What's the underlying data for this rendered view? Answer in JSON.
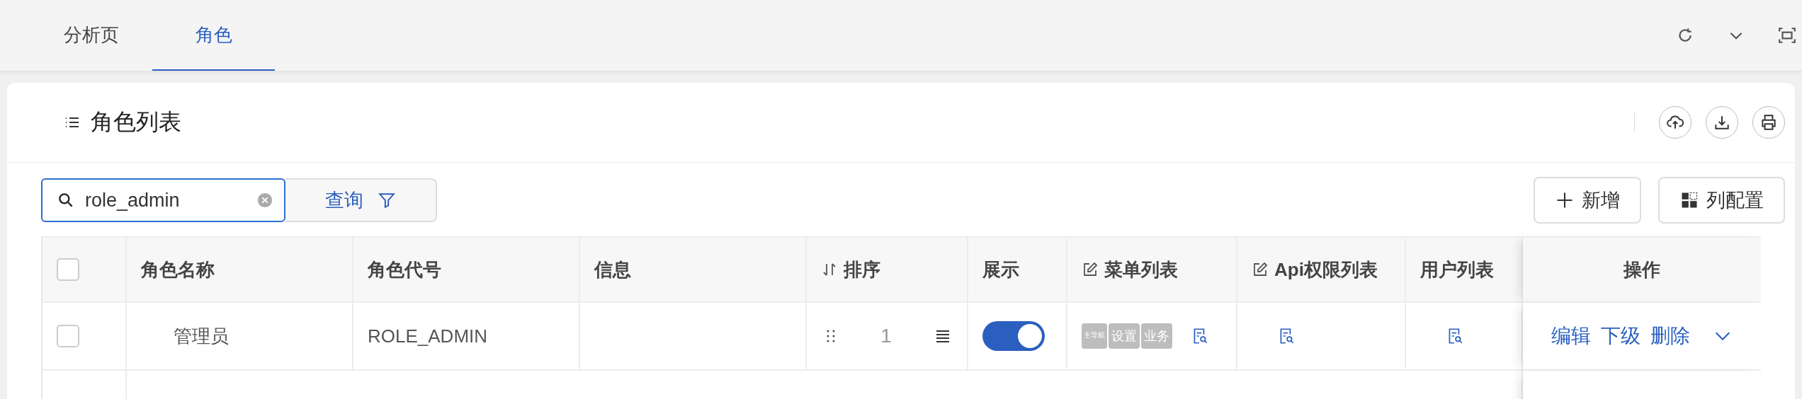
{
  "tabs": [
    {
      "label": "分析页",
      "selected": false
    },
    {
      "label": "角色",
      "selected": true
    }
  ],
  "card": {
    "title": "角色列表"
  },
  "search": {
    "value": "role_admin"
  },
  "query_button": "查询",
  "buttons": [
    {
      "label": "新增",
      "kind": "add"
    },
    {
      "label": "列配置",
      "kind": "columns"
    }
  ],
  "table": {
    "header_checked": false,
    "columns": [
      {
        "label": "角色名称",
        "kind": "plain"
      },
      {
        "label": "角色代号",
        "kind": "plain"
      },
      {
        "label": "信息",
        "kind": "plain"
      },
      {
        "label": "排序",
        "kind": "sortable"
      },
      {
        "label": "展示",
        "kind": "plain"
      },
      {
        "label": "菜单列表",
        "kind": "editable"
      },
      {
        "label": "Api权限列表",
        "kind": "editable"
      },
      {
        "label": "用户列表",
        "kind": "plain"
      },
      {
        "label": "操作",
        "kind": "center"
      }
    ],
    "rows": [
      {
        "checked": false,
        "name": "管理员",
        "code": "ROLE_ADMIN",
        "sort": "1",
        "show": true,
        "menu_tags": [
          "主导航",
          "设置",
          "业务"
        ],
        "actions": [
          "编辑",
          "下级",
          "删除"
        ]
      }
    ]
  }
}
